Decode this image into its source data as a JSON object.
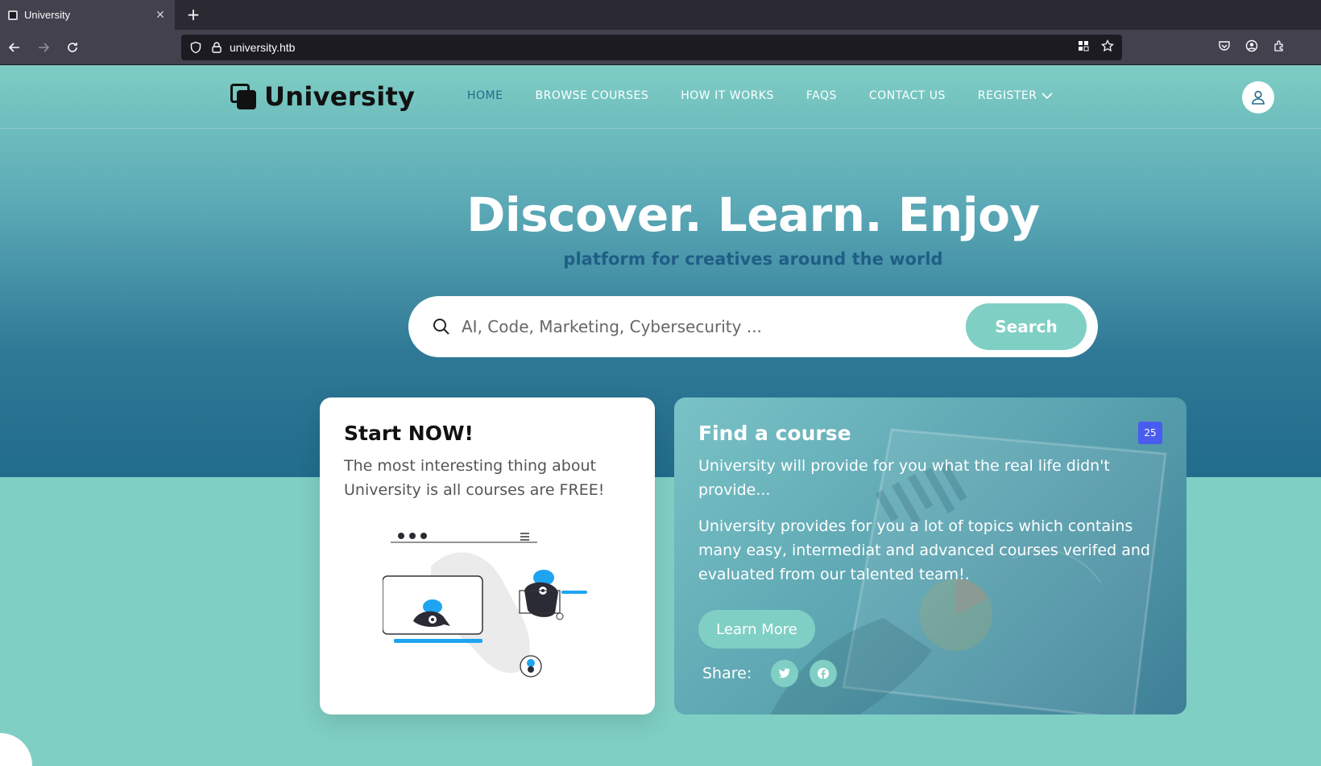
{
  "browser": {
    "tab_title": "University",
    "tab_close": "✕",
    "new_tab": "+",
    "url": "university.htb"
  },
  "site": {
    "logo_text": "University",
    "menu": [
      {
        "label": "HOME",
        "active": true
      },
      {
        "label": "BROWSE COURSES"
      },
      {
        "label": "HOW IT WORKS"
      },
      {
        "label": "FAQS"
      },
      {
        "label": "CONTACT US"
      },
      {
        "label": "REGISTER"
      }
    ]
  },
  "hero": {
    "title": "Discover. Learn. Enjoy",
    "subtitle": "platform for creatives around the world",
    "search_placeholder": "AI, Code, Marketing, Cybersecurity ...",
    "search_button": "Search"
  },
  "start_card": {
    "title": "Start NOW!",
    "text": "The most interesting thing about University is all courses are FREE!"
  },
  "find_card": {
    "title": "Find a course",
    "badge": "25",
    "text1": "University will provide for you what the real life didn't provide...",
    "text2": "University provides for you a lot of topics which contains many easy, intermediat and advanced courses verifed and evaluated from our talented team!.",
    "learn_more": "Learn More",
    "share_label": "Share:"
  },
  "colors": {
    "accent": "#7fcfc4",
    "hero_dark": "#226c8c",
    "subtitle": "#1f5e86",
    "badge": "#4a5cf0"
  },
  "icons": [
    "search-icon",
    "user-icon",
    "chevron-down-icon",
    "twitter-icon",
    "facebook-icon",
    "back-icon",
    "forward-icon",
    "reload-icon",
    "shield-icon",
    "lock-icon",
    "grid-icon",
    "star-icon",
    "pocket-icon",
    "account-icon",
    "extensions-icon"
  ]
}
